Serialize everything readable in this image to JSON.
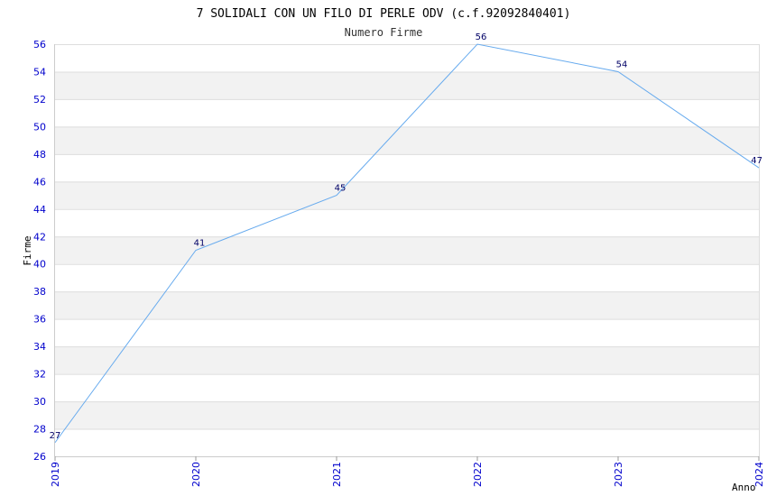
{
  "chart_data": {
    "type": "line",
    "title": "7 SOLIDALI CON UN FILO DI PERLE ODV (c.f.92092840401)",
    "subtitle": "Numero Firme",
    "xlabel": "Anno",
    "ylabel": "Firme",
    "x": [
      "2019",
      "2020",
      "2021",
      "2022",
      "2023",
      "2024"
    ],
    "series": [
      {
        "values": [
          27,
          41,
          45,
          56,
          54,
          47
        ],
        "data_labels": [
          "27",
          "41",
          "45",
          "56",
          "54",
          "47"
        ]
      }
    ],
    "ylim": [
      26,
      56
    ],
    "yticks": [
      "26",
      "28",
      "30",
      "32",
      "34",
      "36",
      "38",
      "40",
      "42",
      "44",
      "46",
      "48",
      "50",
      "52",
      "54",
      "56"
    ],
    "grid": true,
    "band_color": "#f2f2f2",
    "grid_color": "#dddddd",
    "line_color": "#66aaee",
    "tick_color": "#0000cc",
    "label_color": "#000066"
  }
}
